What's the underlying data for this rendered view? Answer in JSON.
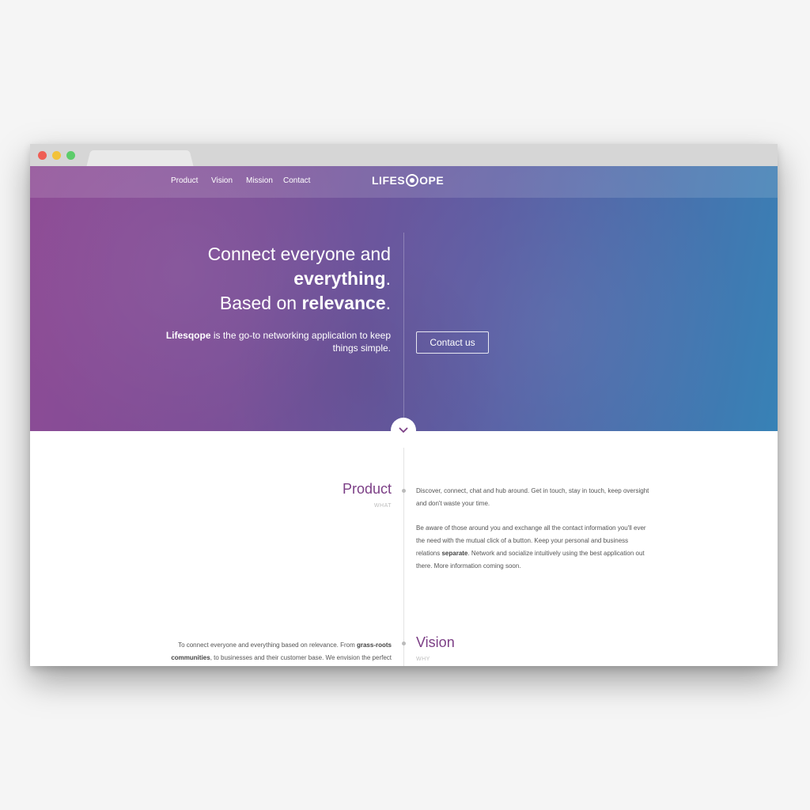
{
  "nav": {
    "items": [
      "Product",
      "Vision",
      "Mission",
      "Contact"
    ],
    "logo": "LIFESQOPE"
  },
  "hero": {
    "headline_line1": "Connect everyone and",
    "headline_bold1": "everything",
    "headline_line3_pre": "Based on ",
    "headline_bold2": "relevance",
    "tagline_brand": "Lifesqope",
    "tagline_rest": " is the go-to networking application to keep things simple.",
    "cta_label": "Contact us"
  },
  "product": {
    "title": "Product",
    "subtitle": "WHAT",
    "para1": "Discover, connect, chat and hub around. Get in touch, stay in touch, keep oversight and don't waste your time.",
    "para2_pre": "Be aware of those around you and exchange all the contact information you'll ever the need with the mutual click of a button. Keep your personal and business relations ",
    "para2_bold": "separate",
    "para2_post": ". Network and socialize intuitively using the best application out there. More information coming soon."
  },
  "vision": {
    "title": "Vision",
    "subtitle": "WHY",
    "text_pre": "To connect everyone and everything based on relevance. From ",
    "text_bold": "grass-roots communities",
    "text_post": ", to businesses and their customer base. We envision the perfect"
  },
  "colors": {
    "accent": "#7c3f86",
    "gradient_start": "#8e4b95",
    "gradient_end": "#3782b6"
  }
}
